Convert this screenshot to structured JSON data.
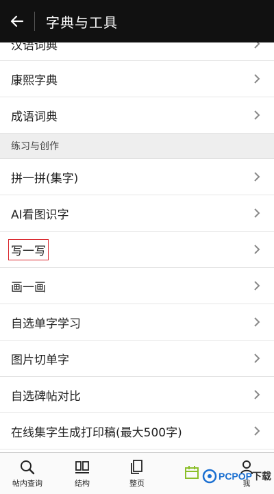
{
  "header": {
    "title": "字典与工具"
  },
  "list": {
    "top_items": [
      "汉语词典",
      "康熙字典",
      "成语词典"
    ],
    "section_label": "练习与创作",
    "section_items": [
      "拼一拼(集字)",
      "AI看图识字",
      "写一写",
      "画一画",
      "自选单字学习",
      "图片切单字",
      "自选碑帖对比",
      "在线集字生成打印稿(最大500字)"
    ]
  },
  "tabbar": {
    "tabs": [
      {
        "label": "帖内查询",
        "icon": "search-icon"
      },
      {
        "label": "结构",
        "icon": "structure-icon"
      },
      {
        "label": "整页",
        "icon": "page-icon"
      },
      {
        "label": "",
        "icon": "calendar-icon"
      },
      {
        "label": "我",
        "icon": "user-icon"
      }
    ]
  },
  "watermark": {
    "brand": "PCPOP",
    "suffix": "下载"
  },
  "colors": {
    "header_bg": "#111111",
    "highlight_border": "#d9232a",
    "icon_green": "#8bbf2a",
    "brand_blue": "#1a6fd1"
  }
}
